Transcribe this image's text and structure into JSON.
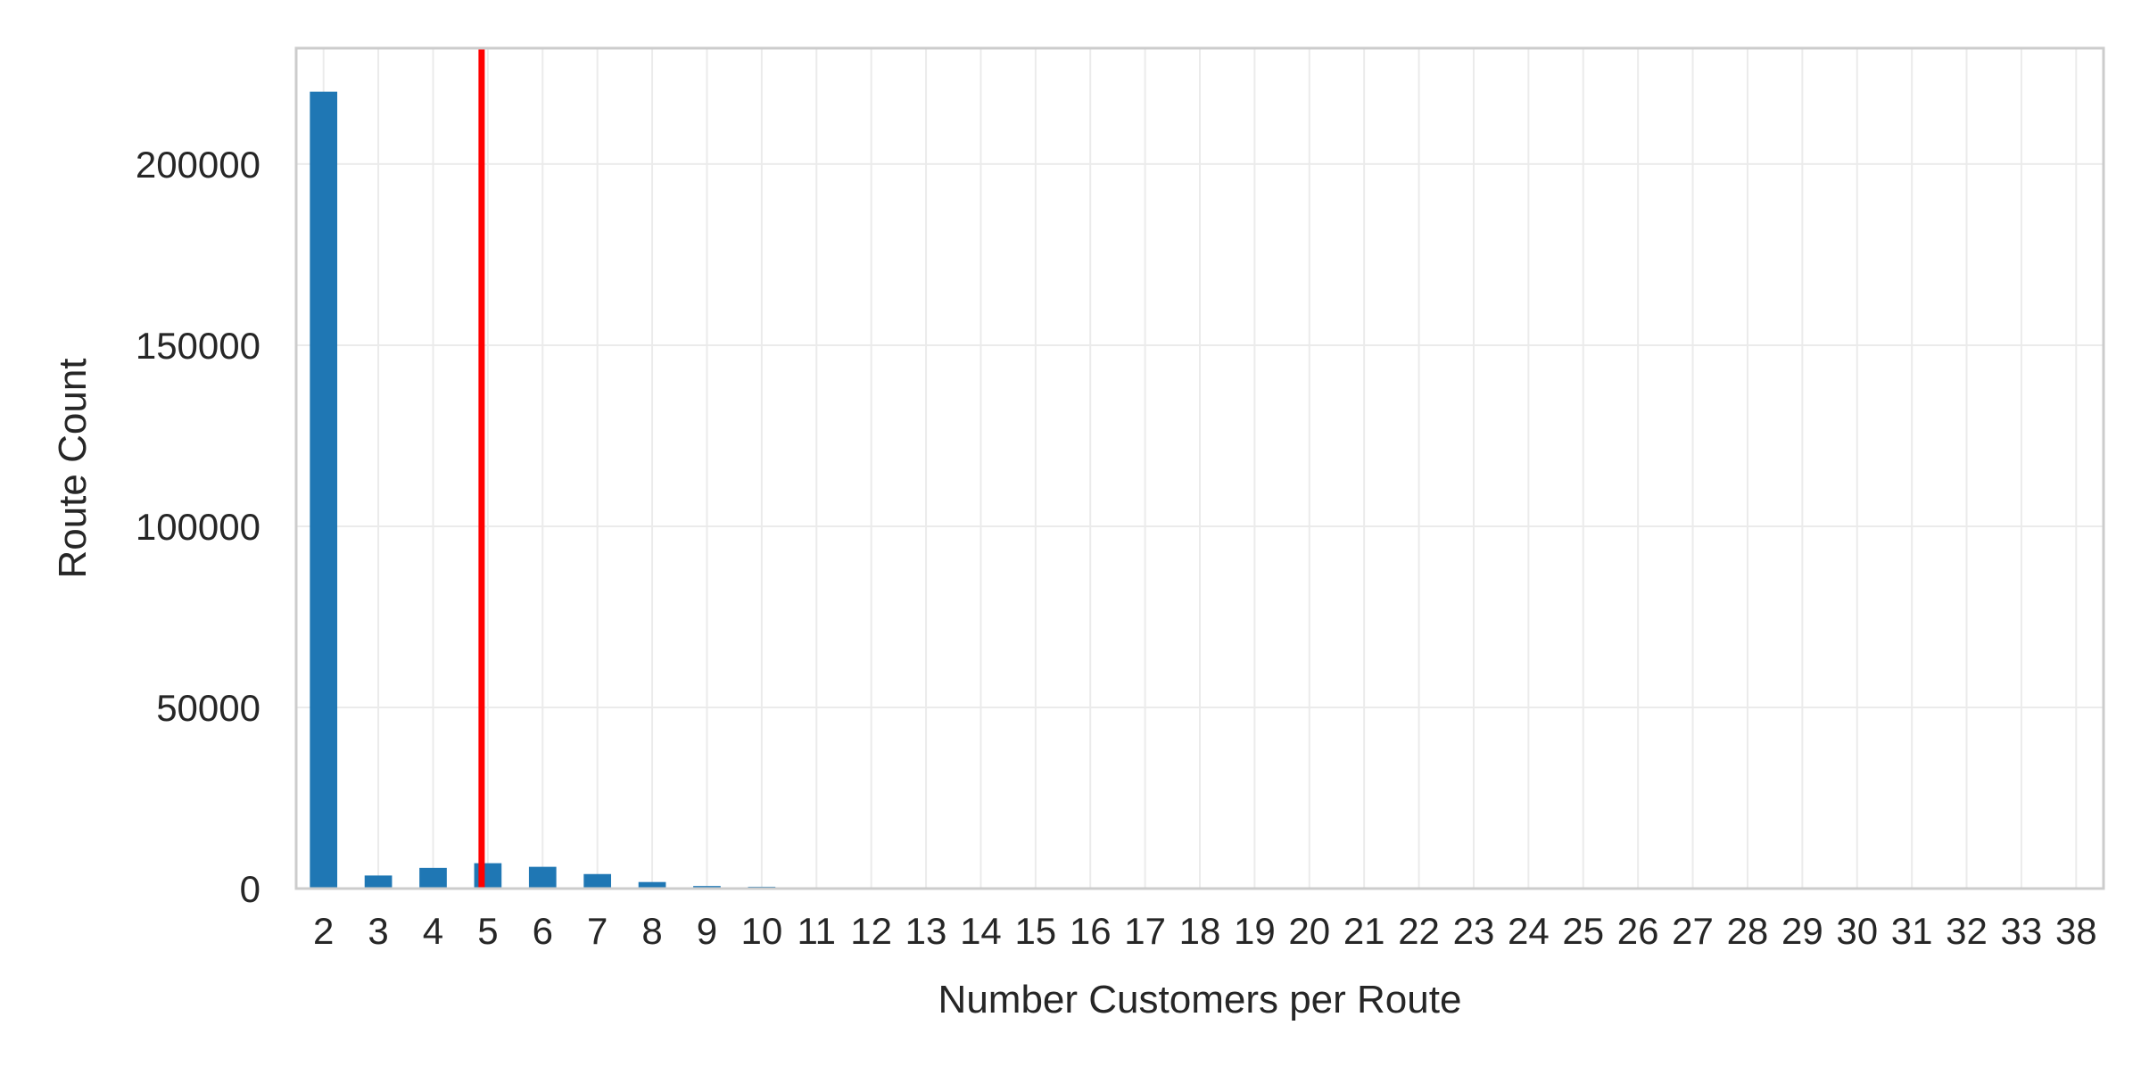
{
  "chart_data": {
    "type": "bar",
    "title": "",
    "xlabel": "Number Customers per Route",
    "ylabel": "Route Count",
    "categories": [
      "2",
      "3",
      "4",
      "5",
      "6",
      "7",
      "8",
      "9",
      "10",
      "11",
      "12",
      "13",
      "14",
      "15",
      "16",
      "17",
      "18",
      "19",
      "20",
      "21",
      "22",
      "23",
      "24",
      "25",
      "26",
      "27",
      "28",
      "29",
      "30",
      "31",
      "32",
      "33",
      "38"
    ],
    "values": [
      220000,
      3600,
      5700,
      7000,
      6000,
      4000,
      1800,
      700,
      500,
      300,
      100,
      60,
      40,
      30,
      20,
      10,
      10,
      5,
      5,
      5,
      5,
      3,
      3,
      2,
      2,
      2,
      1,
      1,
      1,
      1,
      1,
      1,
      1
    ],
    "ylim": [
      0,
      232000
    ],
    "yticks": [
      0,
      50000,
      100000,
      150000,
      200000
    ],
    "grid": true,
    "bar_color": "#1f77b4",
    "reference_line": {
      "category": "5",
      "color": "#ff0000"
    }
  }
}
